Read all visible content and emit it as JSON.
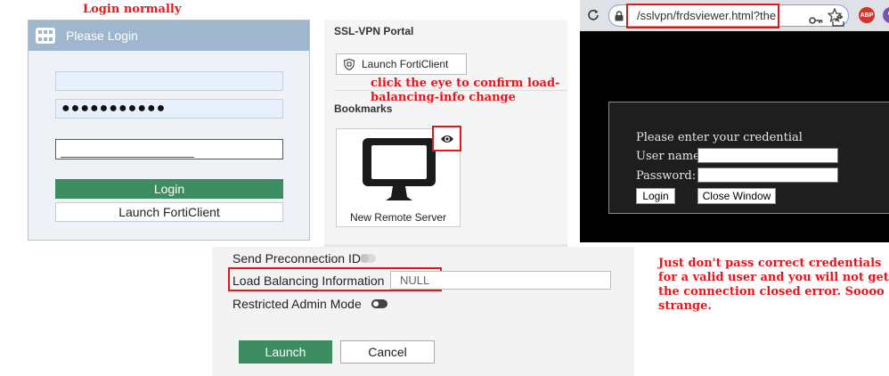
{
  "annotations": {
    "login_normally": "Login normally",
    "eye_hint": "click the eye to confirm load-balancing-info change",
    "credentials_hint": "Just don't pass correct credentials for a valid user and you will not get the connection closed error. Soooo strange."
  },
  "login": {
    "header": "Please Login",
    "password_value": "●●●●●●●●●●●",
    "login_button": "Login",
    "launch_forticlient_button": "Launch FortiClient"
  },
  "portal": {
    "title": "SSL-VPN Portal",
    "launch_forticlient_button": "Launch FortiClient",
    "bookmarks_title": "Bookmarks",
    "bookmark_label": "New Remote Server"
  },
  "browser": {
    "url": "/sslvpn/frdsviewer.html?the",
    "abp_label": "ABP",
    "credential": {
      "title": "Please enter your credential",
      "username_label": "User name:",
      "password_label": "Password:",
      "login_button": "Login",
      "close_button": "Close Window"
    }
  },
  "launch_dialog": {
    "send_preconnection_id_label": "Send Preconnection ID",
    "send_preconnection_id_on": false,
    "load_balancing_label": "Load Balancing Information",
    "load_balancing_value": "NULL",
    "restricted_admin_label": "Restricted Admin Mode",
    "restricted_admin_on": false,
    "launch_button": "Launch",
    "cancel_button": "Cancel"
  },
  "colors": {
    "annotation_red": "#e8141c",
    "primary_green": "#3d8c62",
    "login_header_blue": "#9fb6cf"
  }
}
